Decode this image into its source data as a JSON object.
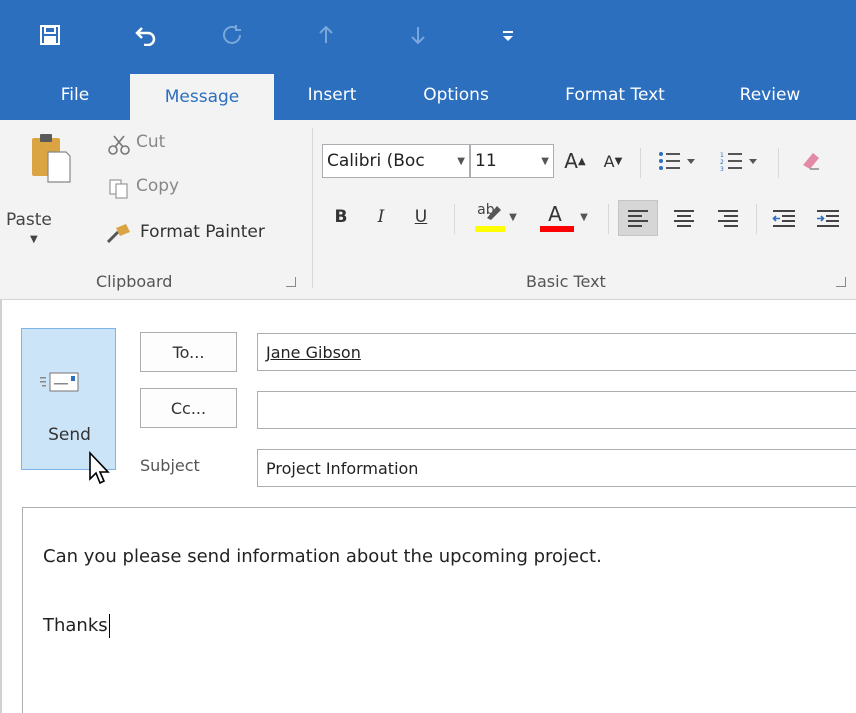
{
  "quick_access": {
    "items": [
      "save",
      "undo",
      "redo",
      "up",
      "down",
      "customize"
    ]
  },
  "tabs": [
    {
      "label": "File",
      "active": false
    },
    {
      "label": "Message",
      "active": true
    },
    {
      "label": "Insert",
      "active": false
    },
    {
      "label": "Options",
      "active": false
    },
    {
      "label": "Format Text",
      "active": false
    },
    {
      "label": "Review",
      "active": false
    }
  ],
  "ribbon": {
    "clipboard": {
      "paste_label": "Paste",
      "cut_label": "Cut",
      "copy_label": "Copy",
      "format_painter_label": "Format Painter",
      "group_label": "Clipboard"
    },
    "basic_text": {
      "font_name": "Calibri (Boc",
      "font_size": "11",
      "bold_label": "B",
      "italic_label": "I",
      "underline_label": "U",
      "highlight_label": "ab",
      "font_color_label": "A",
      "grow_font_label": "A",
      "shrink_font_label": "A",
      "group_label": "Basic Text"
    }
  },
  "message": {
    "send_label": "Send",
    "to_button": "To...",
    "cc_button": "Cc...",
    "subject_label": "Subject",
    "to_value": "Jane Gibson",
    "cc_value": "",
    "subject_value": "Project Information"
  },
  "body": {
    "line1": "Can you please send information about the upcoming project.",
    "line2": "Thanks"
  },
  "colors": {
    "title_bar": "#2b6fbe",
    "ribbon_bg": "#f3f3f3",
    "send_bg": "#cce4f7",
    "highlight_yellow": "#ffff00",
    "font_color_red": "#ff0000"
  }
}
